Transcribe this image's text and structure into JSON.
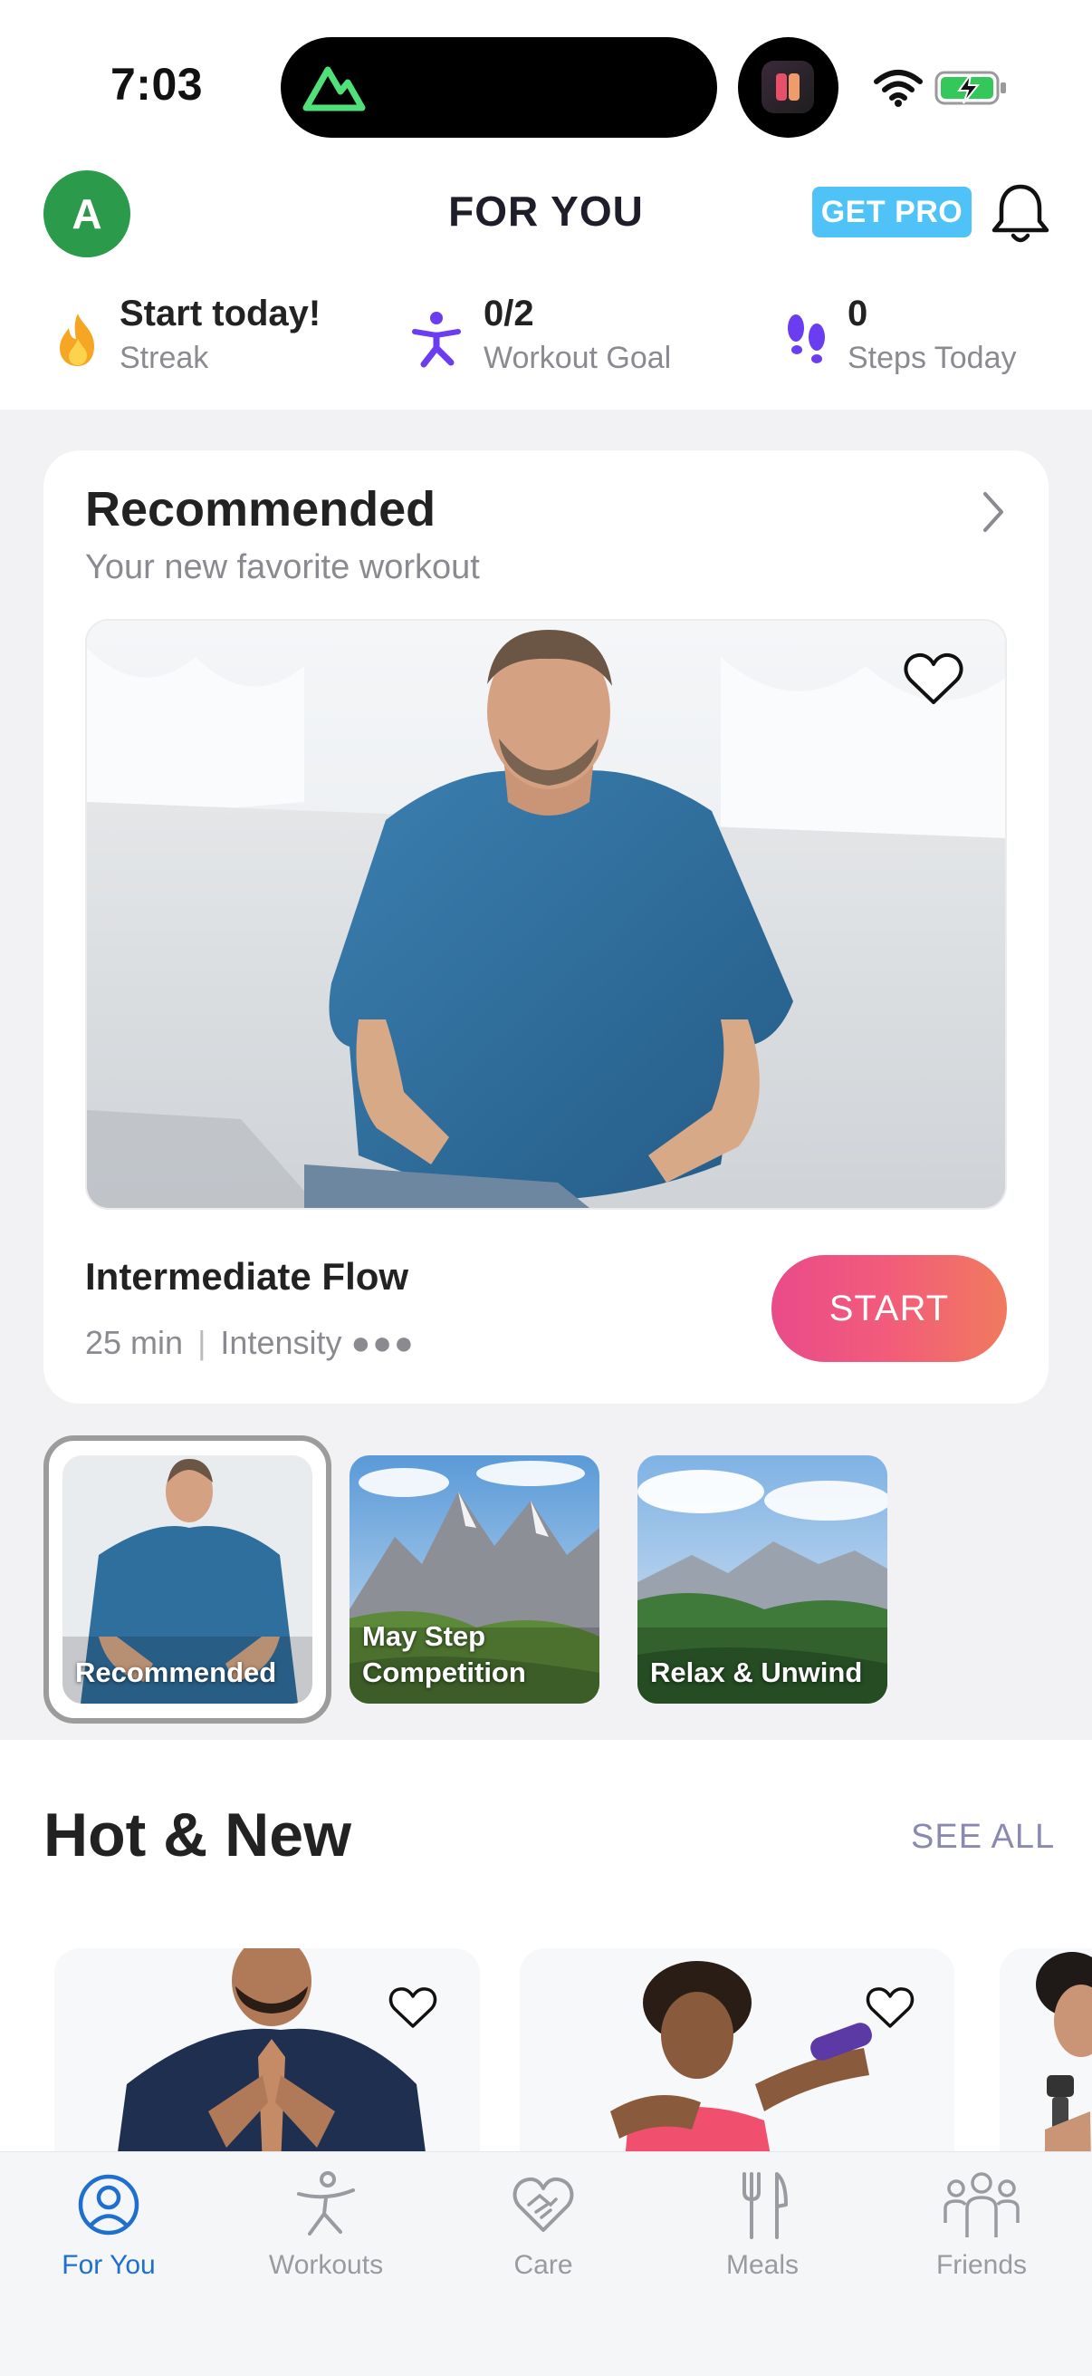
{
  "status_bar": {
    "time": "7:03"
  },
  "header": {
    "avatar_initial": "A",
    "title": "FOR YOU",
    "get_pro": "GET PRO"
  },
  "stats": [
    {
      "main": "Start today!",
      "sub": "Streak",
      "icon": "flame-icon"
    },
    {
      "main": "0/2",
      "sub": "Workout Goal",
      "icon": "person-stretch-icon"
    },
    {
      "main": "0",
      "sub": "Steps Today",
      "icon": "footprints-icon"
    }
  ],
  "recommended": {
    "title": "Recommended",
    "subtitle": "Your new favorite workout",
    "workout_name": "Intermediate Flow",
    "duration": "25 min",
    "separator": "|",
    "intensity_label": "Intensity",
    "intensity_dots": "●●●",
    "start": "START"
  },
  "programs": [
    {
      "label": "Recommended",
      "selected": true
    },
    {
      "label": "May Step Competition",
      "selected": false
    },
    {
      "label": "Relax & Unwind",
      "selected": false
    }
  ],
  "hot_new": {
    "title": "Hot & New",
    "see_all": "SEE ALL"
  },
  "tabs": [
    {
      "label": "For You",
      "icon": "person-circle-icon",
      "active": true
    },
    {
      "label": "Workouts",
      "icon": "stretching-figure-icon",
      "active": false
    },
    {
      "label": "Care",
      "icon": "heart-handshake-icon",
      "active": false
    },
    {
      "label": "Meals",
      "icon": "fork-knife-icon",
      "active": false
    },
    {
      "label": "Friends",
      "icon": "group-icon",
      "active": false
    }
  ],
  "colors": {
    "accent_blue": "#1f6fcf",
    "avatar_green": "#2b9a4a",
    "pro_badge": "#4fc3f7",
    "start_gradient_start": "#e94b8a",
    "start_gradient_end": "#f07a5e",
    "stat_purple": "#6a3df0"
  }
}
